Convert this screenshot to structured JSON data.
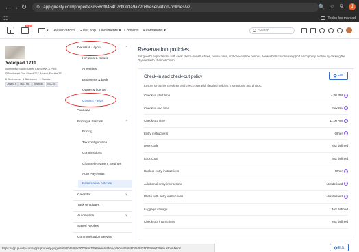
{
  "browser": {
    "url": "app.guesty.com/properties/658df045407cff003a9a7208/reservation-policies/v2",
    "bookmark_folder": "Todos los marcad",
    "profile_initial": "J"
  },
  "header": {
    "calendar_badge": "NEW",
    "nav_items": [
      "Reservations",
      "Guest app",
      "Documents ▾",
      "Contacts",
      "Automations ▾"
    ],
    "search_placeholder": "Search"
  },
  "listing": {
    "title": "Yotelpad 1711",
    "subtitle": "Wonderful Studio Great City Views & Pool",
    "address": "Northeast 2nd Street 227, Miami, Florida 33...",
    "rooms": "0 Bedrooms · 1 Bathroom · 4 Guests",
    "tags": [
      "Johana K",
      "M&D Inv..",
      "Registrat..",
      "MIA-Do.."
    ]
  },
  "sidenav": {
    "items": [
      {
        "label": "Details & Layout",
        "chev": "^"
      },
      {
        "label": "Location & details"
      },
      {
        "label": "Amenities"
      },
      {
        "label": "Bedrooms & beds"
      },
      {
        "label": "Owner & license"
      },
      {
        "label": "Custom Fields"
      },
      {
        "label": "Overview"
      },
      {
        "label": "Pricing & Policies",
        "chev": "^"
      },
      {
        "label": "Pricing"
      },
      {
        "label": "Tax configuration"
      },
      {
        "label": "Commissions"
      },
      {
        "label": "Channel Payment Settings"
      },
      {
        "label": "Auto Payments"
      },
      {
        "label": "Reservation policies"
      },
      {
        "label": "Calendar",
        "chev": "v"
      },
      {
        "label": "Task templates"
      },
      {
        "label": "Automation",
        "chev": "v"
      },
      {
        "label": "Saved Replies"
      },
      {
        "label": "Communication Service"
      }
    ]
  },
  "main": {
    "title": "Reservation policies",
    "description": "Set guest's expectations with clear check-in instructions, house rules, and cancellation policies. View which channels support each policy section by clicking the \"Synced with channels\" icon.",
    "card": {
      "title": "Check-in and check-out policy",
      "edit_label": "Edit",
      "description": "Ensure smoother check-ins and check-outs with detailed policies, instructions, and photos.",
      "rows": [
        {
          "label": "Check-in start time",
          "value": "4:00 PM",
          "info": true
        },
        {
          "label": "Check-in end time",
          "value": "Flexible",
          "info": true
        },
        {
          "label": "Check-out time",
          "value": "11:00 AM",
          "info": true
        },
        {
          "label": "Entry instructions",
          "value": "Other",
          "info": true
        },
        {
          "label": "Door code",
          "value": "Not defined",
          "info": false
        },
        {
          "label": "Lock code",
          "value": "Not defined",
          "info": false
        },
        {
          "label": "Backup entry instructions",
          "value": "Other",
          "info": true
        },
        {
          "label": "Additional entry instructions",
          "value": "Not defined",
          "info": true
        },
        {
          "label": "Photo with entry instructions",
          "value": "Not defined",
          "info": true
        },
        {
          "label": "Luggage storage",
          "value": "Not defined",
          "info": false
        },
        {
          "label": "Check-out instructions",
          "value": "Not defined",
          "info": false
        }
      ]
    },
    "second_edit_label": "Edit"
  },
  "status_bar": {
    "text": "https://app.guesty.com/apps/property-page/658df045407cff003a9a7208/reservation-policies/658df045407cff003a9a7208/custom-fields"
  },
  "colors": {
    "accent": "#2f6fd0",
    "annotation": "#d92626",
    "info": "#8a5cf0"
  }
}
